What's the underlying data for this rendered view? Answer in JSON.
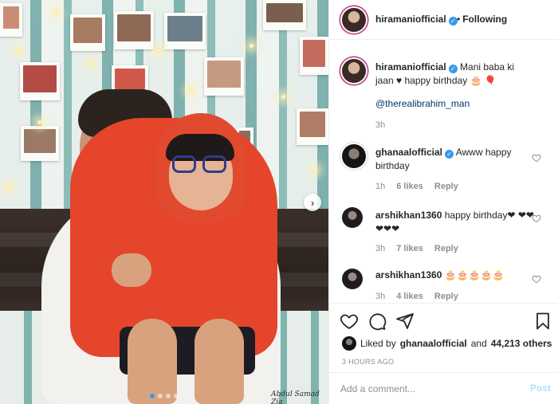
{
  "post": {
    "author": "hiramaniofficial",
    "follow_status": "Following",
    "follow_dot": "•",
    "caption": "Mani baba ki jaan ♥ happy birthday 🎂 🎈",
    "caption_mention": "@therealibrahim_man",
    "caption_time": "3h",
    "photo_watermark": "Abdul Samad Zia",
    "carousel": {
      "count": 4,
      "active_index": 0
    }
  },
  "comments": [
    {
      "username": "ghanaalofficial",
      "verified": true,
      "text": "Awww happy birthday",
      "time": "1h",
      "likes": "6 likes",
      "reply": "Reply"
    },
    {
      "username": "arshikhan1360",
      "verified": false,
      "text": "happy birthday❤ ❤❤❤❤❤",
      "time": "3h",
      "likes": "7 likes",
      "reply": "Reply"
    },
    {
      "username": "arshikhan1360",
      "verified": false,
      "text": "🎂🎂🎂🎂🎂",
      "time": "3h",
      "likes": "4 likes",
      "reply": "Reply"
    }
  ],
  "actions": {
    "liked_by_prefix": "Liked by",
    "liked_by_user": "ghanaalofficial",
    "liked_by_and": "and",
    "likes_others": "44,213 others",
    "time_ago": "3 HOURS AGO"
  },
  "add_comment": {
    "placeholder": "Add a comment...",
    "post_label": "Post"
  },
  "colors": {
    "link": "#00376b",
    "verified": "#3897f0",
    "post_disabled": "#b2dffc",
    "muted": "#8e8e8e"
  },
  "icons": [
    "heart-icon",
    "comment-icon",
    "share-icon",
    "bookmark-icon",
    "chevron-right-icon",
    "verified-badge-icon"
  ]
}
